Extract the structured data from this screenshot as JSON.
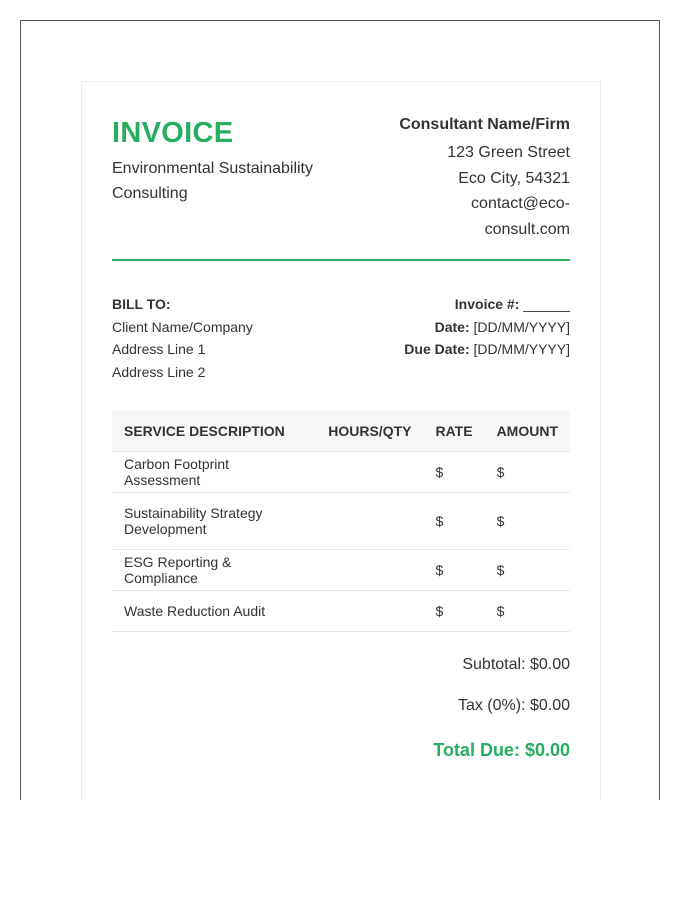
{
  "header": {
    "title": "INVOICE",
    "tagline": "Environmental Sustainability Consulting"
  },
  "consultant": {
    "name": "Consultant Name/Firm",
    "street": "123 Green Street",
    "city": "Eco City, 54321",
    "email_line1": "contact@eco-",
    "email_line2": "consult.com"
  },
  "bill_to": {
    "heading": "BILL TO:",
    "client": "Client Name/Company",
    "address1": "Address Line 1",
    "address2": "Address Line 2"
  },
  "invoice_meta": {
    "number_label": "Invoice #:",
    "number_value": "______",
    "date_label": "Date:",
    "date_value": "[DD/MM/YYYY]",
    "due_label": "Due Date:",
    "due_value": "[DD/MM/YYYY]"
  },
  "table": {
    "headers": [
      "SERVICE DESCRIPTION",
      "HOURS/QTY",
      "RATE",
      "AMOUNT"
    ],
    "rows": [
      {
        "description": "Carbon Footprint Assessment",
        "hours": "",
        "rate": "$",
        "amount": "$"
      },
      {
        "description": "Sustainability Strategy Development",
        "hours": "",
        "rate": "$",
        "amount": "$"
      },
      {
        "description": "ESG Reporting & Compliance",
        "hours": "",
        "rate": "$",
        "amount": "$"
      },
      {
        "description": "Waste Reduction Audit",
        "hours": "",
        "rate": "$",
        "amount": "$"
      }
    ]
  },
  "totals": {
    "subtotal": "Subtotal: $0.00",
    "tax": "Tax (0%): $0.00",
    "total_due": "Total Due: $0.00"
  },
  "colors": {
    "accent": "#27ae60",
    "text": "#333333",
    "table_header_bg": "#f6f7f8"
  }
}
